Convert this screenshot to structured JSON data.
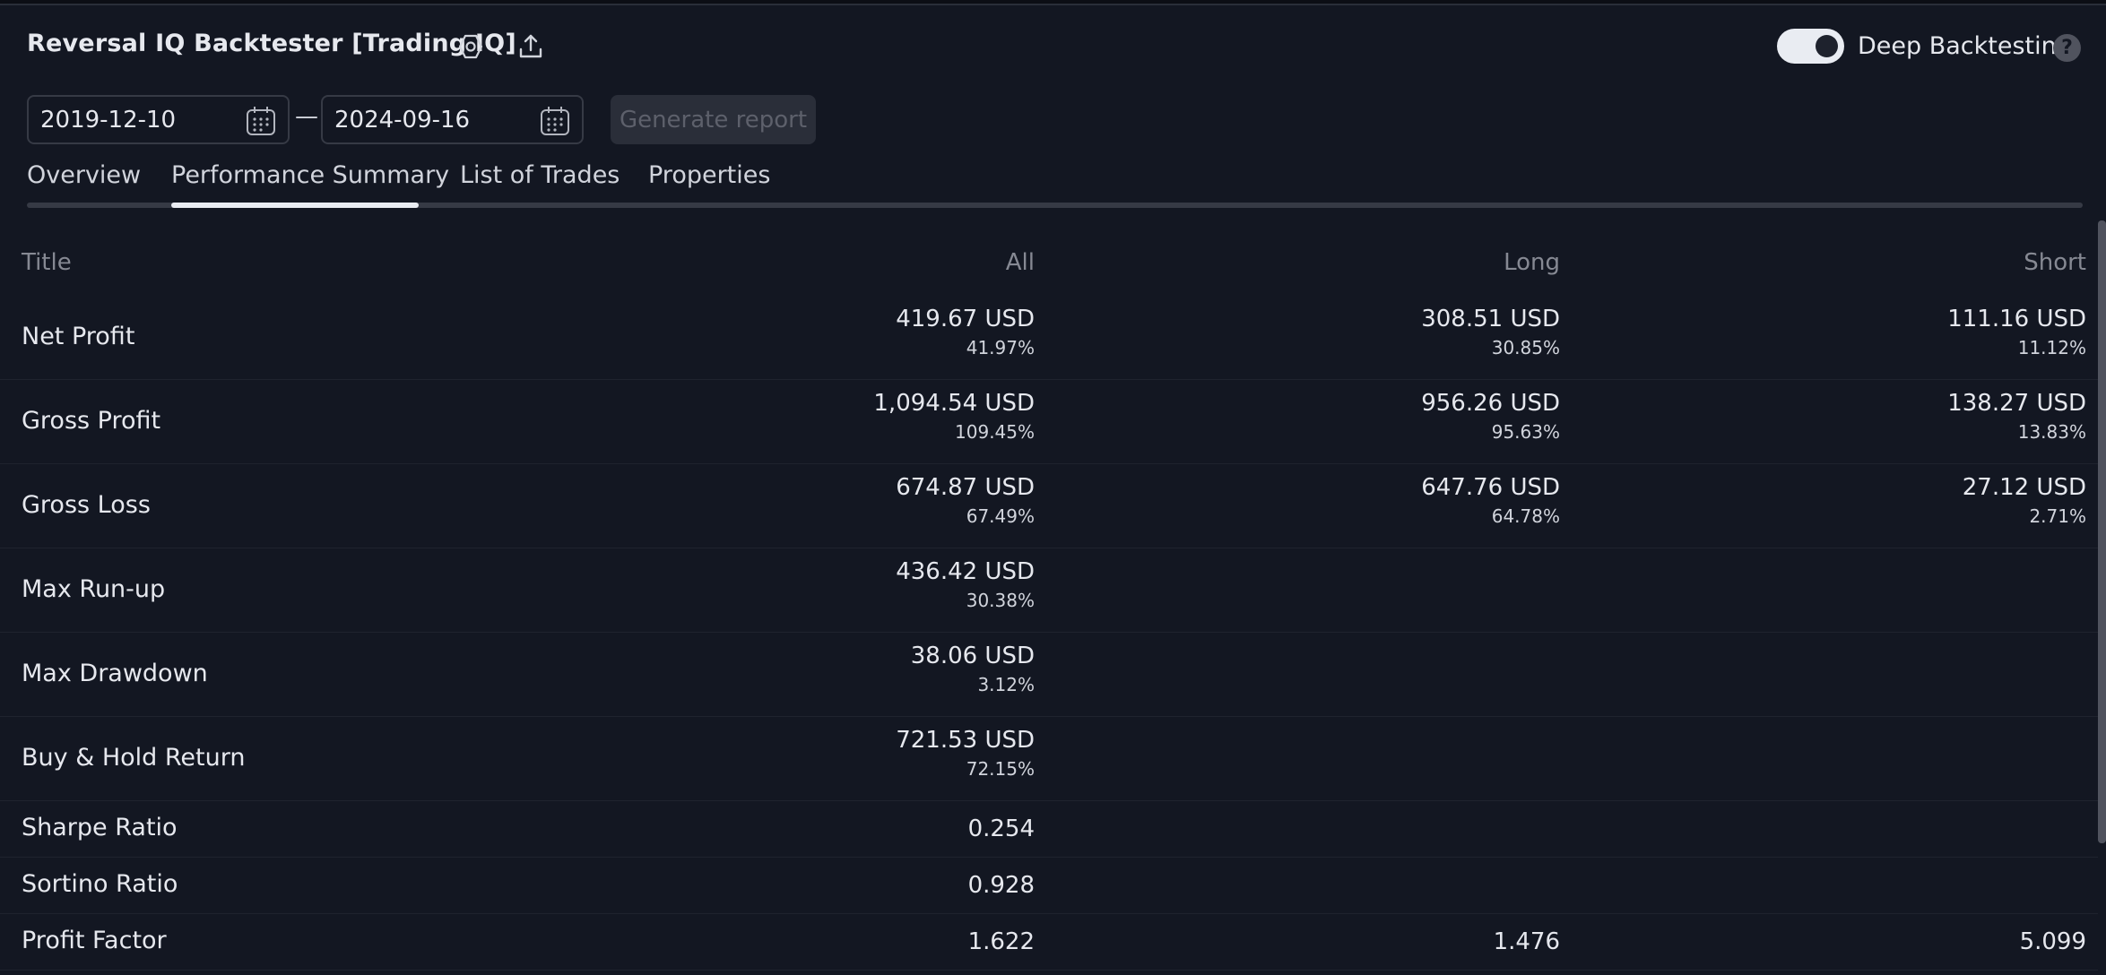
{
  "header": {
    "title": "Reversal IQ Backtester [Trading IQ]",
    "settings_icon": "hexagon-settings-icon",
    "export_icon": "export-upload-icon",
    "deep_backtesting_label": "Deep Backtesting",
    "deep_backtesting_enabled": true,
    "help_icon_text": "?"
  },
  "range": {
    "start": "2019-12-10",
    "separator": "—",
    "end": "2024-09-16",
    "generate_label": "Generate report"
  },
  "tabs": [
    {
      "label": "Overview"
    },
    {
      "label": "Performance Summary",
      "active": true
    },
    {
      "label": "List of Trades"
    },
    {
      "label": "Properties"
    }
  ],
  "table": {
    "columns": [
      "Title",
      "All",
      "Long",
      "Short"
    ],
    "rows": [
      {
        "title": "Net Profit",
        "all": {
          "value": "419.67 USD",
          "pct": "41.97%"
        },
        "long": {
          "value": "308.51 USD",
          "pct": "30.85%"
        },
        "short": {
          "value": "111.16 USD",
          "pct": "11.12%"
        }
      },
      {
        "title": "Gross Profit",
        "all": {
          "value": "1,094.54 USD",
          "pct": "109.45%"
        },
        "long": {
          "value": "956.26 USD",
          "pct": "95.63%"
        },
        "short": {
          "value": "138.27 USD",
          "pct": "13.83%"
        }
      },
      {
        "title": "Gross Loss",
        "all": {
          "value": "674.87 USD",
          "pct": "67.49%"
        },
        "long": {
          "value": "647.76 USD",
          "pct": "64.78%"
        },
        "short": {
          "value": "27.12 USD",
          "pct": "2.71%"
        }
      },
      {
        "title": "Max Run-up",
        "all": {
          "value": "436.42 USD",
          "pct": "30.38%"
        }
      },
      {
        "title": "Max Drawdown",
        "all": {
          "value": "38.06 USD",
          "pct": "3.12%"
        }
      },
      {
        "title": "Buy & Hold Return",
        "all": {
          "value": "721.53 USD",
          "pct": "72.15%"
        }
      },
      {
        "title": "Sharpe Ratio",
        "all": {
          "value": "0.254"
        }
      },
      {
        "title": "Sortino Ratio",
        "all": {
          "value": "0.928"
        }
      },
      {
        "title": "Profit Factor",
        "all": {
          "value": "1.622"
        },
        "long": {
          "value": "1.476"
        },
        "short": {
          "value": "5.099"
        }
      }
    ]
  },
  "colors": {
    "background": "#131722",
    "text": "#d1d4dc",
    "muted": "#868993",
    "accent": "#e9ecf2"
  }
}
